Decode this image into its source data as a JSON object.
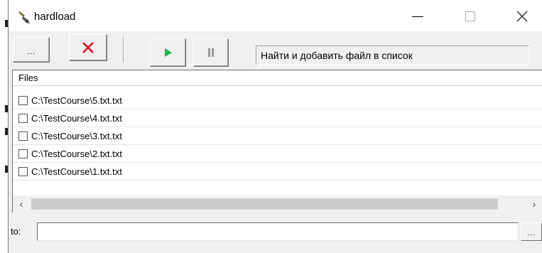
{
  "window": {
    "title": "hardload",
    "icon": "shovel-icon"
  },
  "toolbar": {
    "browse_label": "...",
    "delete_icon": "red-x-icon",
    "start_icon": "play-icon",
    "pause_icon": "pause-icon",
    "status_text": "Найти и добавить файл в список"
  },
  "file_list": {
    "header": "Files",
    "items": [
      {
        "label": "C:\\TestCourse\\5.txt.txt",
        "checked": false
      },
      {
        "label": "C:\\TestCourse\\4.txt.txt",
        "checked": false
      },
      {
        "label": "C:\\TestCourse\\3.txt.txt",
        "checked": false
      },
      {
        "label": "C:\\TestCourse\\2.txt.txt",
        "checked": false
      },
      {
        "label": "C:\\TestCourse\\1.txt.txt",
        "checked": false
      }
    ]
  },
  "destination": {
    "label": "to:",
    "value": "",
    "browse_label": "..."
  },
  "colors": {
    "delete_red": "#e81123",
    "play_green": "#22b14c",
    "pause_gray": "#9a9a9a"
  }
}
